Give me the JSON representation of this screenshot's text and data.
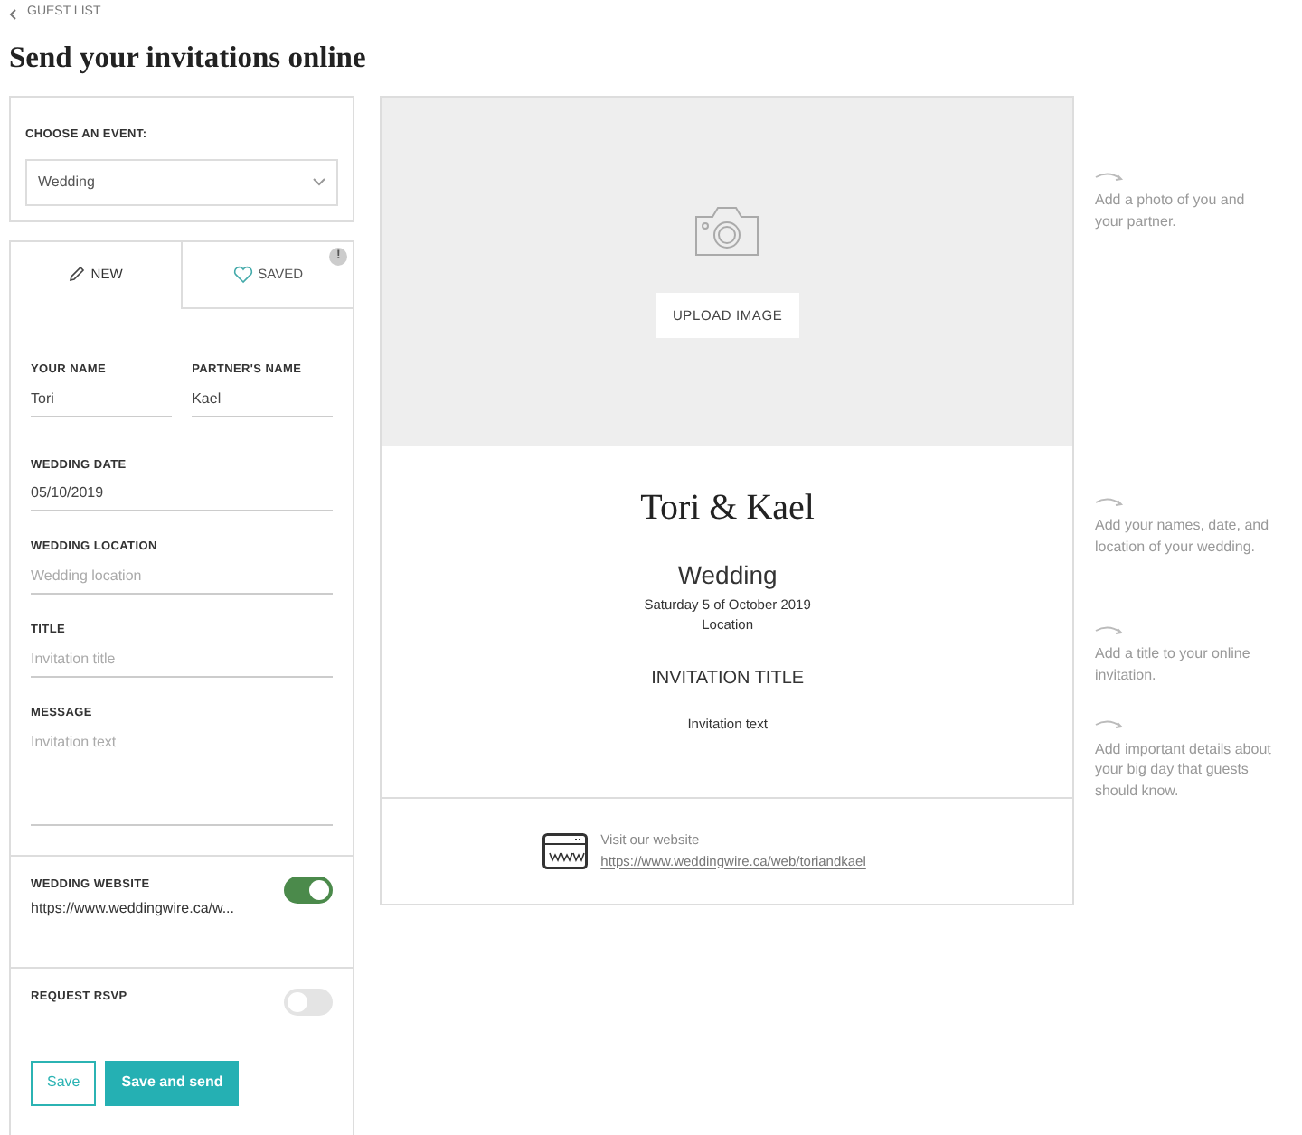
{
  "back_link": {
    "label": "GUEST LIST"
  },
  "title": "Send your invitations online",
  "event_select": {
    "label": "CHOOSE AN EVENT:",
    "value": "Wedding"
  },
  "tabs": [
    {
      "label": "NEW",
      "selected": true
    },
    {
      "label": "SAVED",
      "selected": false
    }
  ],
  "tab_alert": "!",
  "name_fields": [
    {
      "label": "YOUR NAME",
      "value": "Tori"
    },
    {
      "label": "PARTNER'S NAME",
      "value": "Kael"
    }
  ],
  "fields": [
    {
      "kind": "input",
      "label": "WEDDING DATE",
      "value": "05/10/2019"
    },
    {
      "kind": "input",
      "label": "WEDDING LOCATION",
      "placeholder": "Wedding location"
    },
    {
      "kind": "input",
      "label": "TITLE",
      "placeholder": "Invitation title"
    },
    {
      "kind": "textarea",
      "label": "MESSAGE",
      "placeholder": "Invitation text"
    }
  ],
  "toggles": [
    {
      "label": "WEDDING WEBSITE",
      "value": "https://www.weddingwire.ca/w...",
      "on": true
    },
    {
      "label": "REQUEST RSVP",
      "on": false
    }
  ],
  "buttons": [
    {
      "label": "Save",
      "kind": "outline"
    },
    {
      "label": "Save and send",
      "kind": "primary"
    }
  ],
  "preview": {
    "upload_button": "UPLOAD IMAGE",
    "names": "Tori & Kael",
    "event": "Wedding",
    "date": "Saturday 5 of October 2019",
    "location": "Location",
    "invitation_title": "INVITATION TITLE",
    "invitation_text": "Invitation text",
    "website_caption": "Visit our website",
    "website_url": "https://www.weddingwire.ca/web/toriandkael"
  },
  "hints": [
    "Add a photo of you and your partner.",
    "Add your names, date, and location of your wedding.",
    "Add a title to your online invitation.",
    "Add important details about your big day that guests should know."
  ]
}
